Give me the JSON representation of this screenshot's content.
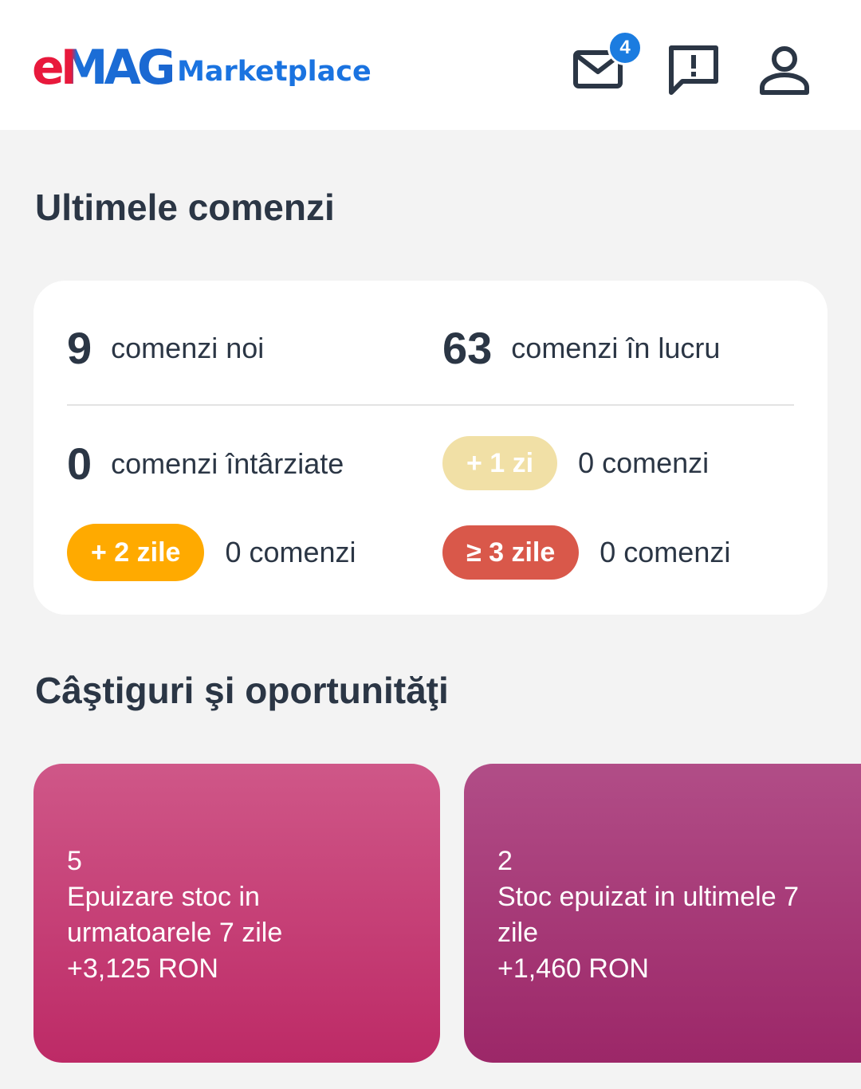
{
  "header": {
    "logo_emag": "eMAG",
    "logo_marketplace": "Marketplace",
    "messages_badge": "4",
    "icons": [
      "mail-icon",
      "report-icon",
      "user-icon"
    ]
  },
  "orders": {
    "title": "Ultimele comenzi",
    "new": {
      "count": "9",
      "label": "comenzi noi"
    },
    "in_progress": {
      "count": "63",
      "label": "comenzi în lucru"
    },
    "late": {
      "count": "0",
      "label": "comenzi întârziate"
    },
    "delays": [
      {
        "tag": "+ 1 zi",
        "value": "0 comenzi",
        "color": "#f1e0a6"
      },
      {
        "tag": "+ 2 zile",
        "value": "0 comenzi",
        "color": "#ffaa00"
      },
      {
        "tag": "≥ 3 zile",
        "value": "0 comenzi",
        "color": "#d9584a"
      }
    ]
  },
  "opportunities": {
    "title": "Câştiguri şi oportunităţi",
    "cards": [
      {
        "count": "5",
        "text": "Epuizare stoc in urmatoarele 7 zile",
        "amount": "+3,125 RON",
        "color_top": "#cf5788",
        "color_bottom": "#bd2a66"
      },
      {
        "count": "2",
        "text": "Stoc epuizat in ultimele 7 zile",
        "amount": "+1,460 RON",
        "color_top": "#b14d87",
        "color_bottom": "#9c2768"
      }
    ]
  }
}
